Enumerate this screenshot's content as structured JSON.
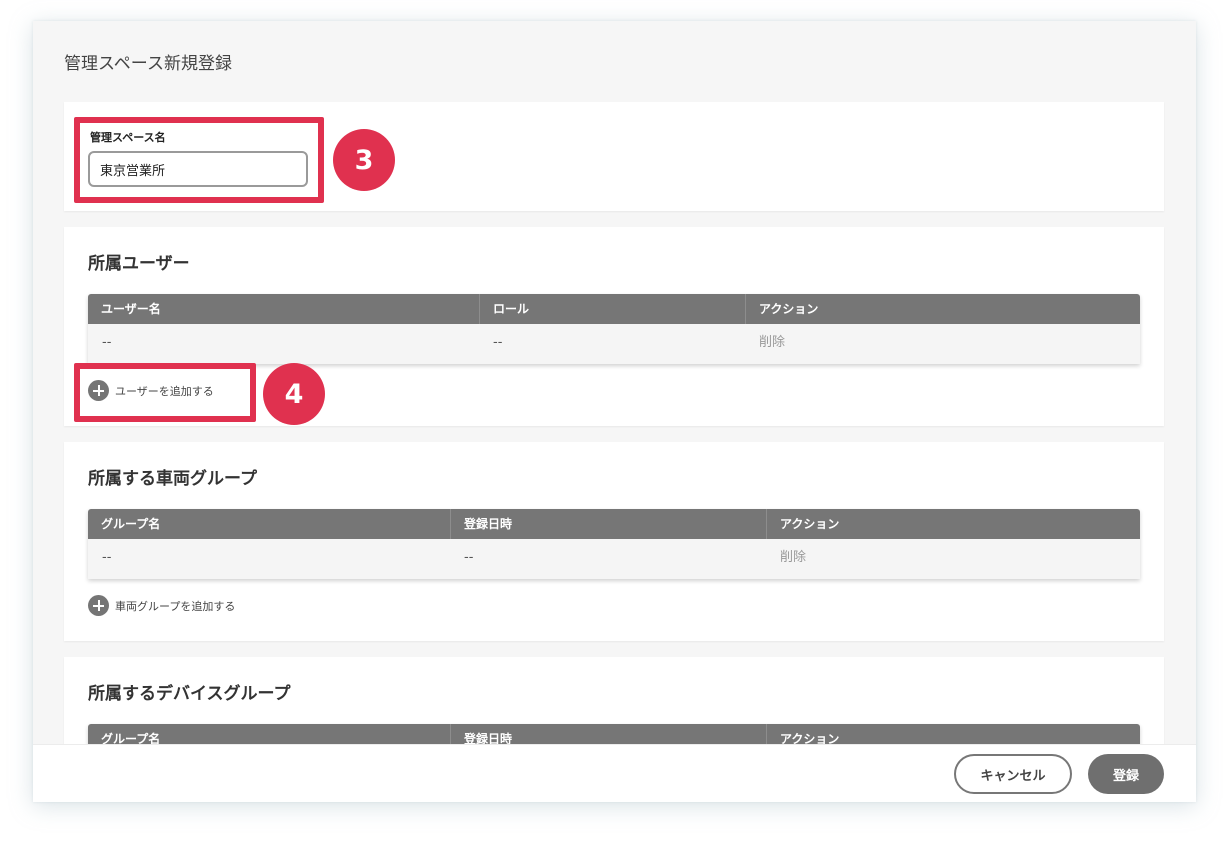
{
  "page": {
    "title": "管理スペース新規登録"
  },
  "space_name": {
    "label": "管理スペース名",
    "value": "東京営業所"
  },
  "annotations": {
    "badge_3": "3",
    "badge_4": "4",
    "highlight_color": "#e0314f"
  },
  "users_section": {
    "title": "所属ユーザー",
    "columns": [
      "ユーザー名",
      "ロール",
      "アクション"
    ],
    "rows": [
      [
        "--",
        "--",
        "削除"
      ]
    ],
    "add_label": "ユーザーを追加する"
  },
  "vehicle_groups_section": {
    "title": "所属する車両グループ",
    "columns": [
      "グループ名",
      "登録日時",
      "アクション"
    ],
    "rows": [
      [
        "--",
        "--",
        "削除"
      ]
    ],
    "add_label": "車両グループを追加する"
  },
  "device_groups_section": {
    "title": "所属するデバイスグループ",
    "columns": [
      "グループ名",
      "登録日時",
      "アクション"
    ]
  },
  "footer": {
    "cancel_label": "キャンセル",
    "submit_label": "登録"
  },
  "icons": {
    "add": "plus-circle-icon"
  }
}
